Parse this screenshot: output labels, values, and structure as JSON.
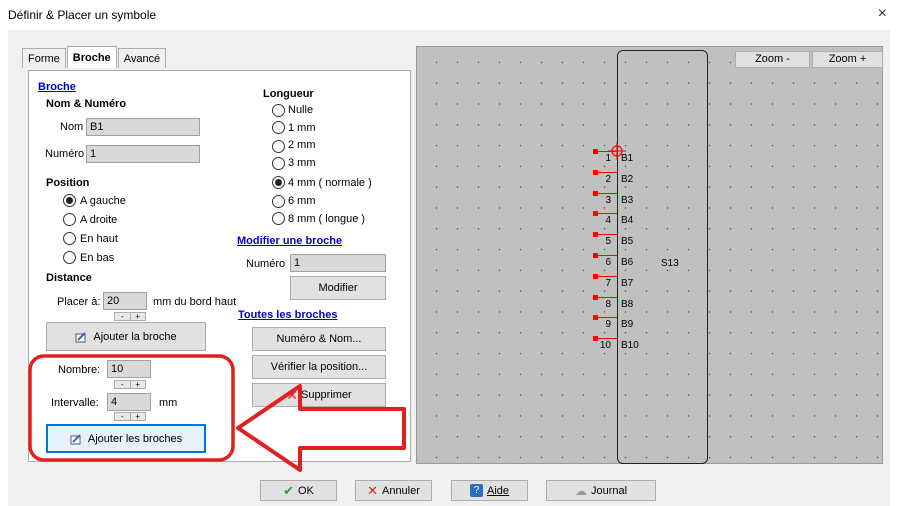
{
  "window": {
    "title": "Définir & Placer un symbole",
    "close_glyph": "×"
  },
  "tabs": [
    "Forme",
    "Broche",
    "Avancé"
  ],
  "broche_link": "Broche",
  "nom_numero": {
    "heading": "Nom & Numéro",
    "nom_label": "Nom",
    "nom_value": "B1",
    "numero_label": "Numéro",
    "numero_value": "1"
  },
  "position": {
    "heading": "Position",
    "options": [
      "A gauche",
      "A droite",
      "En haut",
      "En bas"
    ],
    "selected_index": 0
  },
  "distance": {
    "heading": "Distance",
    "label": "Placer à:",
    "value": "20",
    "suffix": "mm du bord haut"
  },
  "ajouter_broche": "Ajouter la broche",
  "nombre": {
    "label": "Nombre:",
    "value": "10"
  },
  "intervalle": {
    "label": "Intervalle:",
    "value": "4",
    "unit": "mm"
  },
  "ajouter_broches": "Ajouter les broches",
  "spinner": {
    "minus": "-",
    "plus": "+"
  },
  "longueur": {
    "heading": "Longueur",
    "options": [
      "Nulle",
      "1 mm",
      "2 mm",
      "3 mm",
      "4 mm ( normale )",
      "6 mm",
      "8 mm ( longue )"
    ],
    "selected_index": 4
  },
  "modifier": {
    "link": "Modifier une broche",
    "numero_label": "Numéro",
    "numero_value": "1",
    "button": "Modifier"
  },
  "toutes": {
    "link": "Toutes les broches",
    "numero_nom": "Numéro & Nom...",
    "verifier": "Vérifier la position...",
    "supprimer": "Supprimer"
  },
  "zoom": {
    "minus": "Zoom -",
    "plus": "Zoom +"
  },
  "symbol": {
    "label": "S13",
    "pins": [
      {
        "num": "1",
        "name": "B1"
      },
      {
        "num": "2",
        "name": "B2"
      },
      {
        "num": "3",
        "name": "B3"
      },
      {
        "num": "4",
        "name": "B4"
      },
      {
        "num": "5",
        "name": "B5"
      },
      {
        "num": "6",
        "name": "B6"
      },
      {
        "num": "7",
        "name": "B7"
      },
      {
        "num": "8",
        "name": "B8"
      },
      {
        "num": "9",
        "name": "B9"
      },
      {
        "num": "10",
        "name": "B10"
      }
    ]
  },
  "footer": {
    "ok": "OK",
    "annuler": "Annuler",
    "aide": "Aide",
    "journal": "Journal"
  },
  "colors": {
    "annotation": "#e02020",
    "pin": "#ff0000",
    "link": "#0000cc"
  }
}
